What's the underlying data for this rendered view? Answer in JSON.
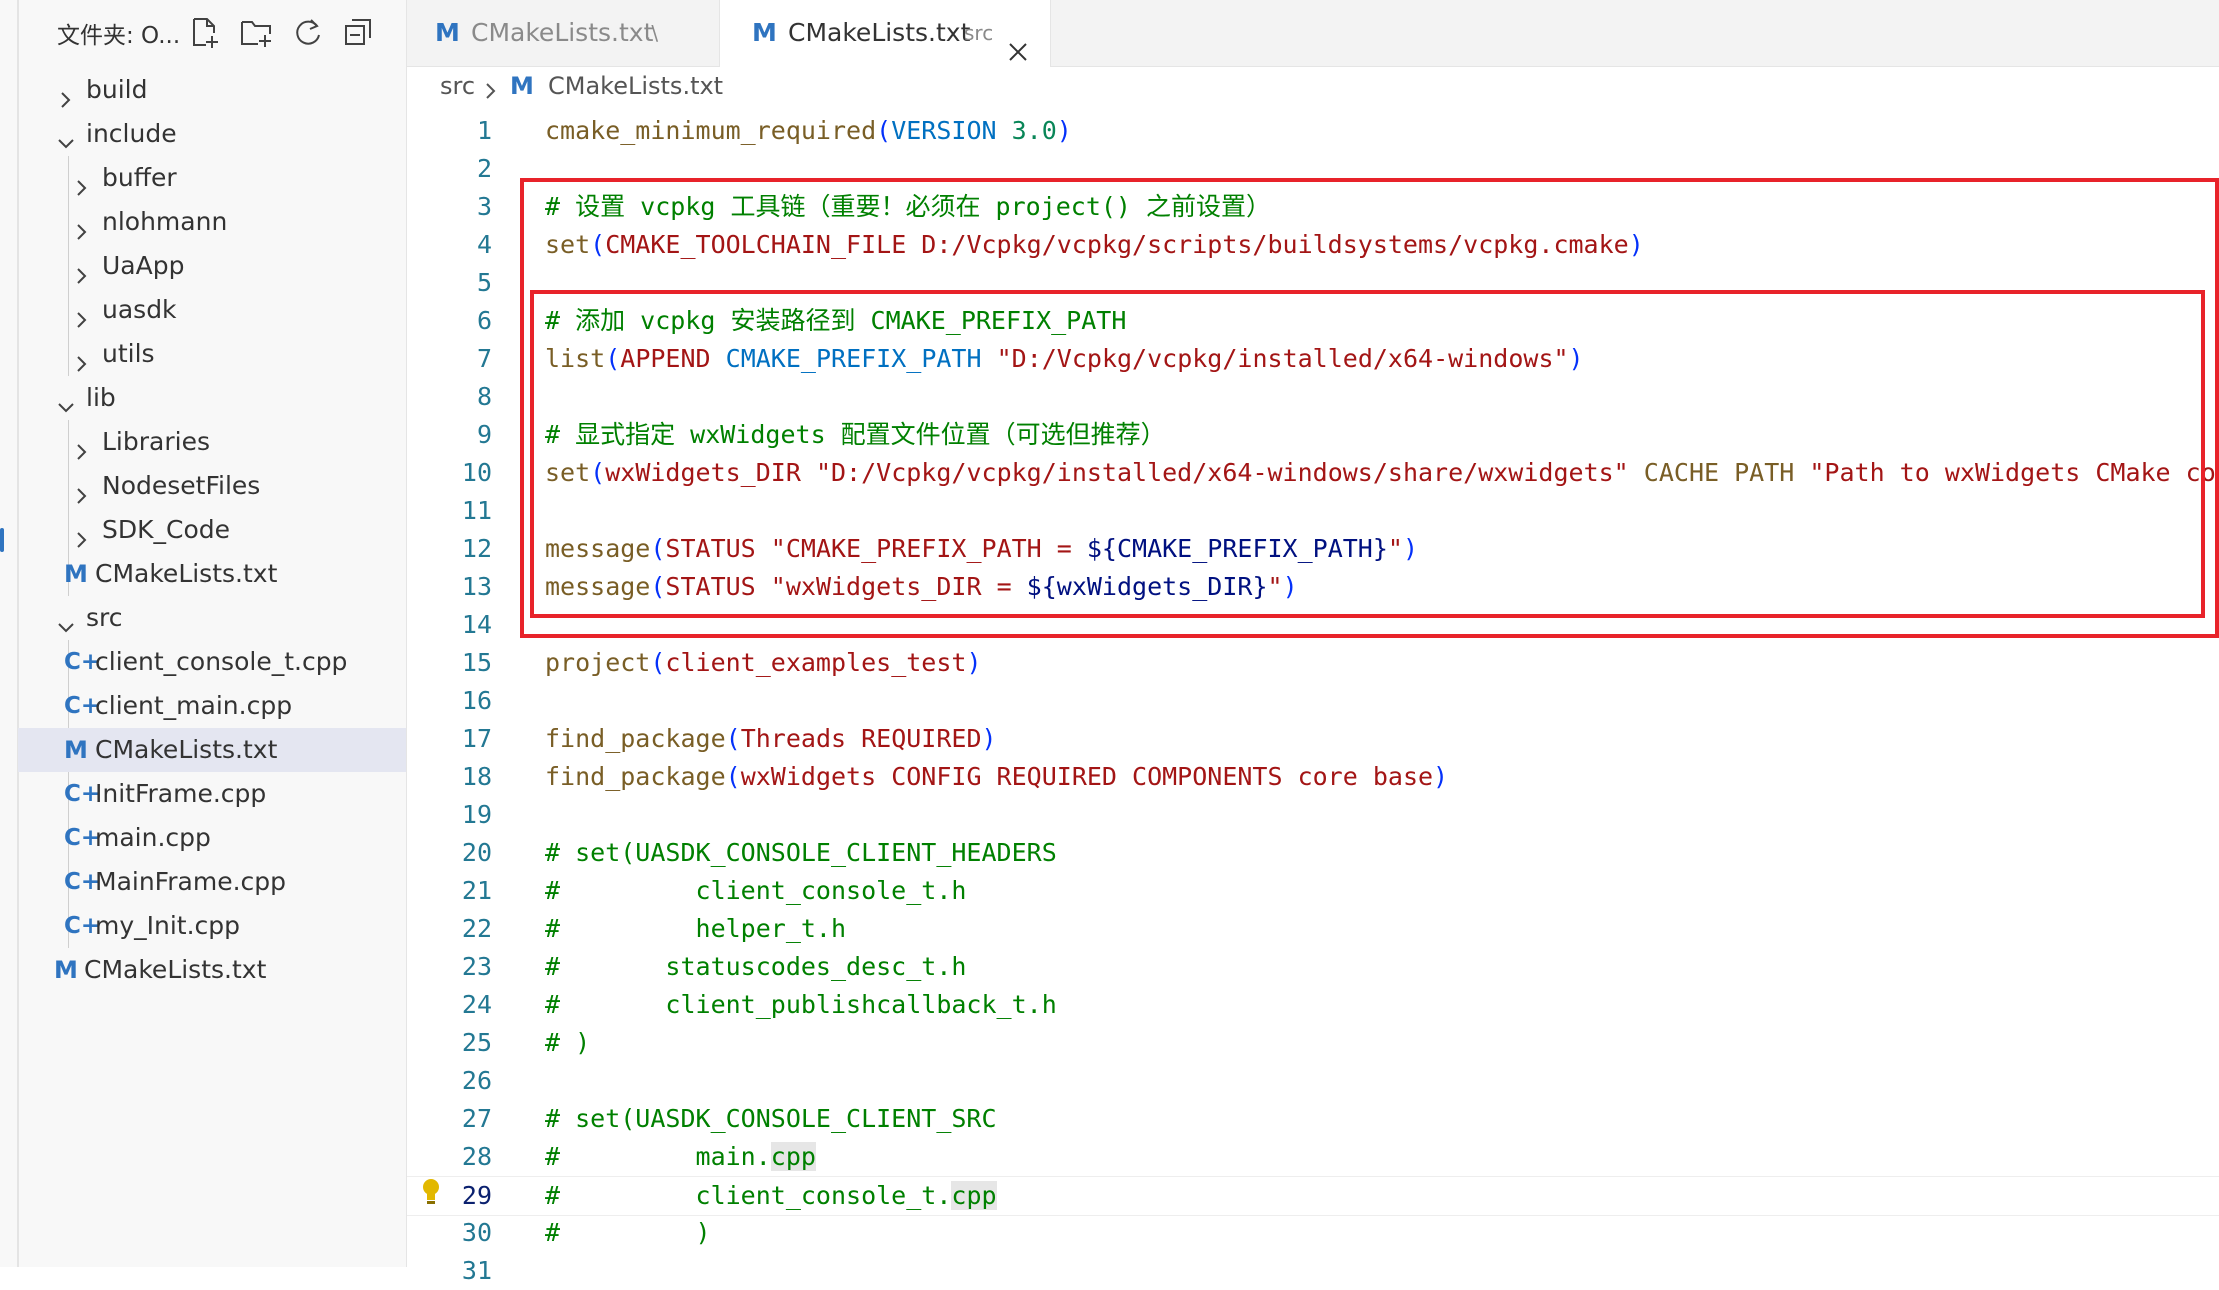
{
  "explorer": {
    "title": "文件夹: O...",
    "items": [
      {
        "label": "build",
        "kind": "folder",
        "state": "collapsed",
        "depth": 0
      },
      {
        "label": "include",
        "kind": "folder",
        "state": "expanded",
        "depth": 0
      },
      {
        "label": "buffer",
        "kind": "folder",
        "state": "collapsed",
        "depth": 1
      },
      {
        "label": "nlohmann",
        "kind": "folder",
        "state": "collapsed",
        "depth": 1
      },
      {
        "label": "UaApp",
        "kind": "folder",
        "state": "collapsed",
        "depth": 1
      },
      {
        "label": "uasdk",
        "kind": "folder",
        "state": "collapsed",
        "depth": 1
      },
      {
        "label": "utils",
        "kind": "folder",
        "state": "collapsed",
        "depth": 1
      },
      {
        "label": "lib",
        "kind": "folder",
        "state": "expanded",
        "depth": 0
      },
      {
        "label": "Libraries",
        "kind": "folder",
        "state": "collapsed",
        "depth": 1
      },
      {
        "label": "NodesetFiles",
        "kind": "folder",
        "state": "collapsed",
        "depth": 1
      },
      {
        "label": "SDK_Code",
        "kind": "folder",
        "state": "collapsed",
        "depth": 1
      },
      {
        "label": "CMakeLists.txt",
        "kind": "cmake",
        "depth": 1
      },
      {
        "label": "src",
        "kind": "folder",
        "state": "expanded",
        "depth": 0
      },
      {
        "label": "client_console_t.cpp",
        "kind": "cpp",
        "depth": 1
      },
      {
        "label": "client_main.cpp",
        "kind": "cpp",
        "depth": 1
      },
      {
        "label": "CMakeLists.txt",
        "kind": "cmake",
        "depth": 1,
        "selected": true
      },
      {
        "label": "InitFrame.cpp",
        "kind": "cpp",
        "depth": 1
      },
      {
        "label": "main.cpp",
        "kind": "cpp",
        "depth": 1
      },
      {
        "label": "MainFrame.cpp",
        "kind": "cpp",
        "depth": 1
      },
      {
        "label": "my_Init.cpp",
        "kind": "cpp",
        "depth": 1
      },
      {
        "label": "CMakeLists.txt",
        "kind": "cmake",
        "depth": 0
      }
    ]
  },
  "tabs": [
    {
      "label": "CMakeLists.txt",
      "description": ".\\",
      "active": false
    },
    {
      "label": "CMakeLists.txt",
      "description": "src",
      "active": true
    }
  ],
  "breadcrumb": {
    "folder": "src",
    "file": "CMakeLists.txt"
  },
  "icons": {
    "cmake_file": "M",
    "cpp_file": "C+"
  },
  "editor": {
    "current_line": 29,
    "lines": [
      {
        "n": "1",
        "t": [
          [
            "fn",
            "cmake_minimum_required"
          ],
          [
            "pn",
            "("
          ],
          [
            "kw",
            "VERSION"
          ],
          [
            "sp",
            " "
          ],
          [
            "num",
            "3.0"
          ],
          [
            "pn",
            ")"
          ]
        ]
      },
      {
        "n": "2",
        "t": []
      },
      {
        "n": "3",
        "t": [
          [
            "cm",
            "# 设置 vcpkg 工具链（重要！必须在 project() 之前设置）"
          ]
        ]
      },
      {
        "n": "4",
        "t": [
          [
            "fn",
            "set"
          ],
          [
            "pn",
            "("
          ],
          [
            "arg",
            "CMAKE_TOOLCHAIN_FILE D:/Vcpkg/vcpkg/scripts/buildsystems/vcpkg.cmake"
          ],
          [
            "pn",
            ")"
          ]
        ]
      },
      {
        "n": "5",
        "t": []
      },
      {
        "n": "6",
        "t": [
          [
            "cm",
            "# 添加 vcpkg 安装路径到 CMAKE_PREFIX_PATH"
          ]
        ]
      },
      {
        "n": "7",
        "t": [
          [
            "fn",
            "list"
          ],
          [
            "pn",
            "("
          ],
          [
            "arg",
            "APPEND"
          ],
          [
            "sp",
            " "
          ],
          [
            "kw",
            "CMAKE_PREFIX_PATH"
          ],
          [
            "sp",
            " "
          ],
          [
            "str",
            "\"D:/Vcpkg/vcpkg/installed/x64-windows\""
          ],
          [
            "pn",
            ")"
          ]
        ]
      },
      {
        "n": "8",
        "t": []
      },
      {
        "n": "9",
        "t": [
          [
            "cm",
            "# 显式指定 wxWidgets 配置文件位置（可选但推荐）"
          ]
        ]
      },
      {
        "n": "10",
        "t": [
          [
            "fn",
            "set"
          ],
          [
            "pn",
            "("
          ],
          [
            "arg",
            "wxWidgets_DIR"
          ],
          [
            "sp",
            " "
          ],
          [
            "str",
            "\"D:/Vcpkg/vcpkg/installed/x64-windows/share/wxwidgets\""
          ],
          [
            "sp",
            " "
          ],
          [
            "fn",
            "CACHE PATH"
          ],
          [
            "sp",
            " "
          ],
          [
            "str",
            "\"Path to wxWidgets CMake config\""
          ],
          [
            "pn",
            ")"
          ]
        ]
      },
      {
        "n": "11",
        "t": []
      },
      {
        "n": "12",
        "t": [
          [
            "fn",
            "message"
          ],
          [
            "pn",
            "("
          ],
          [
            "arg",
            "STATUS"
          ],
          [
            "sp",
            " "
          ],
          [
            "str",
            "\"CMAKE_PREFIX_PATH = "
          ],
          [
            "var",
            "${CMAKE_PREFIX_PATH}"
          ],
          [
            "str",
            "\""
          ],
          [
            "pn",
            ")"
          ]
        ]
      },
      {
        "n": "13",
        "t": [
          [
            "fn",
            "message"
          ],
          [
            "pn",
            "("
          ],
          [
            "arg",
            "STATUS"
          ],
          [
            "sp",
            " "
          ],
          [
            "str",
            "\"wxWidgets_DIR = "
          ],
          [
            "var",
            "${wxWidgets_DIR}"
          ],
          [
            "str",
            "\""
          ],
          [
            "pn",
            ")"
          ]
        ]
      },
      {
        "n": "14",
        "t": []
      },
      {
        "n": "15",
        "t": [
          [
            "fn",
            "project"
          ],
          [
            "pn",
            "("
          ],
          [
            "arg",
            "client_examples_test"
          ],
          [
            "pn",
            ")"
          ]
        ]
      },
      {
        "n": "16",
        "t": []
      },
      {
        "n": "17",
        "t": [
          [
            "fn",
            "find_package"
          ],
          [
            "pn",
            "("
          ],
          [
            "arg",
            "Threads REQUIRED"
          ],
          [
            "pn",
            ")"
          ]
        ]
      },
      {
        "n": "18",
        "t": [
          [
            "fn",
            "find_package"
          ],
          [
            "pn",
            "("
          ],
          [
            "arg",
            "wxWidgets CONFIG REQUIRED COMPONENTS core base"
          ],
          [
            "pn",
            ")"
          ]
        ]
      },
      {
        "n": "19",
        "t": []
      },
      {
        "n": "20",
        "t": [
          [
            "cm",
            "# set(UASDK_CONSOLE_CLIENT_HEADERS"
          ]
        ]
      },
      {
        "n": "21",
        "t": [
          [
            "cm",
            "#         client_console_t.h"
          ]
        ]
      },
      {
        "n": "22",
        "t": [
          [
            "cm",
            "#         helper_t.h"
          ]
        ]
      },
      {
        "n": "23",
        "t": [
          [
            "cm",
            "#       statuscodes_desc_t.h"
          ]
        ]
      },
      {
        "n": "24",
        "t": [
          [
            "cm",
            "#       client_publishcallback_t.h"
          ]
        ]
      },
      {
        "n": "25",
        "t": [
          [
            "cm",
            "# )"
          ]
        ]
      },
      {
        "n": "26",
        "t": []
      },
      {
        "n": "27",
        "t": [
          [
            "cm",
            "# set(UASDK_CONSOLE_CLIENT_SRC"
          ]
        ]
      },
      {
        "n": "28",
        "t": [
          [
            "cm",
            "#         main."
          ],
          [
            "cmhl",
            "cpp"
          ]
        ]
      },
      {
        "n": "29",
        "t": [
          [
            "cm",
            "#         client_console_t."
          ],
          [
            "cmhl",
            "cpp"
          ]
        ]
      },
      {
        "n": "30",
        "t": [
          [
            "cm",
            "#         )"
          ]
        ]
      },
      {
        "n": "31",
        "t": []
      }
    ]
  }
}
